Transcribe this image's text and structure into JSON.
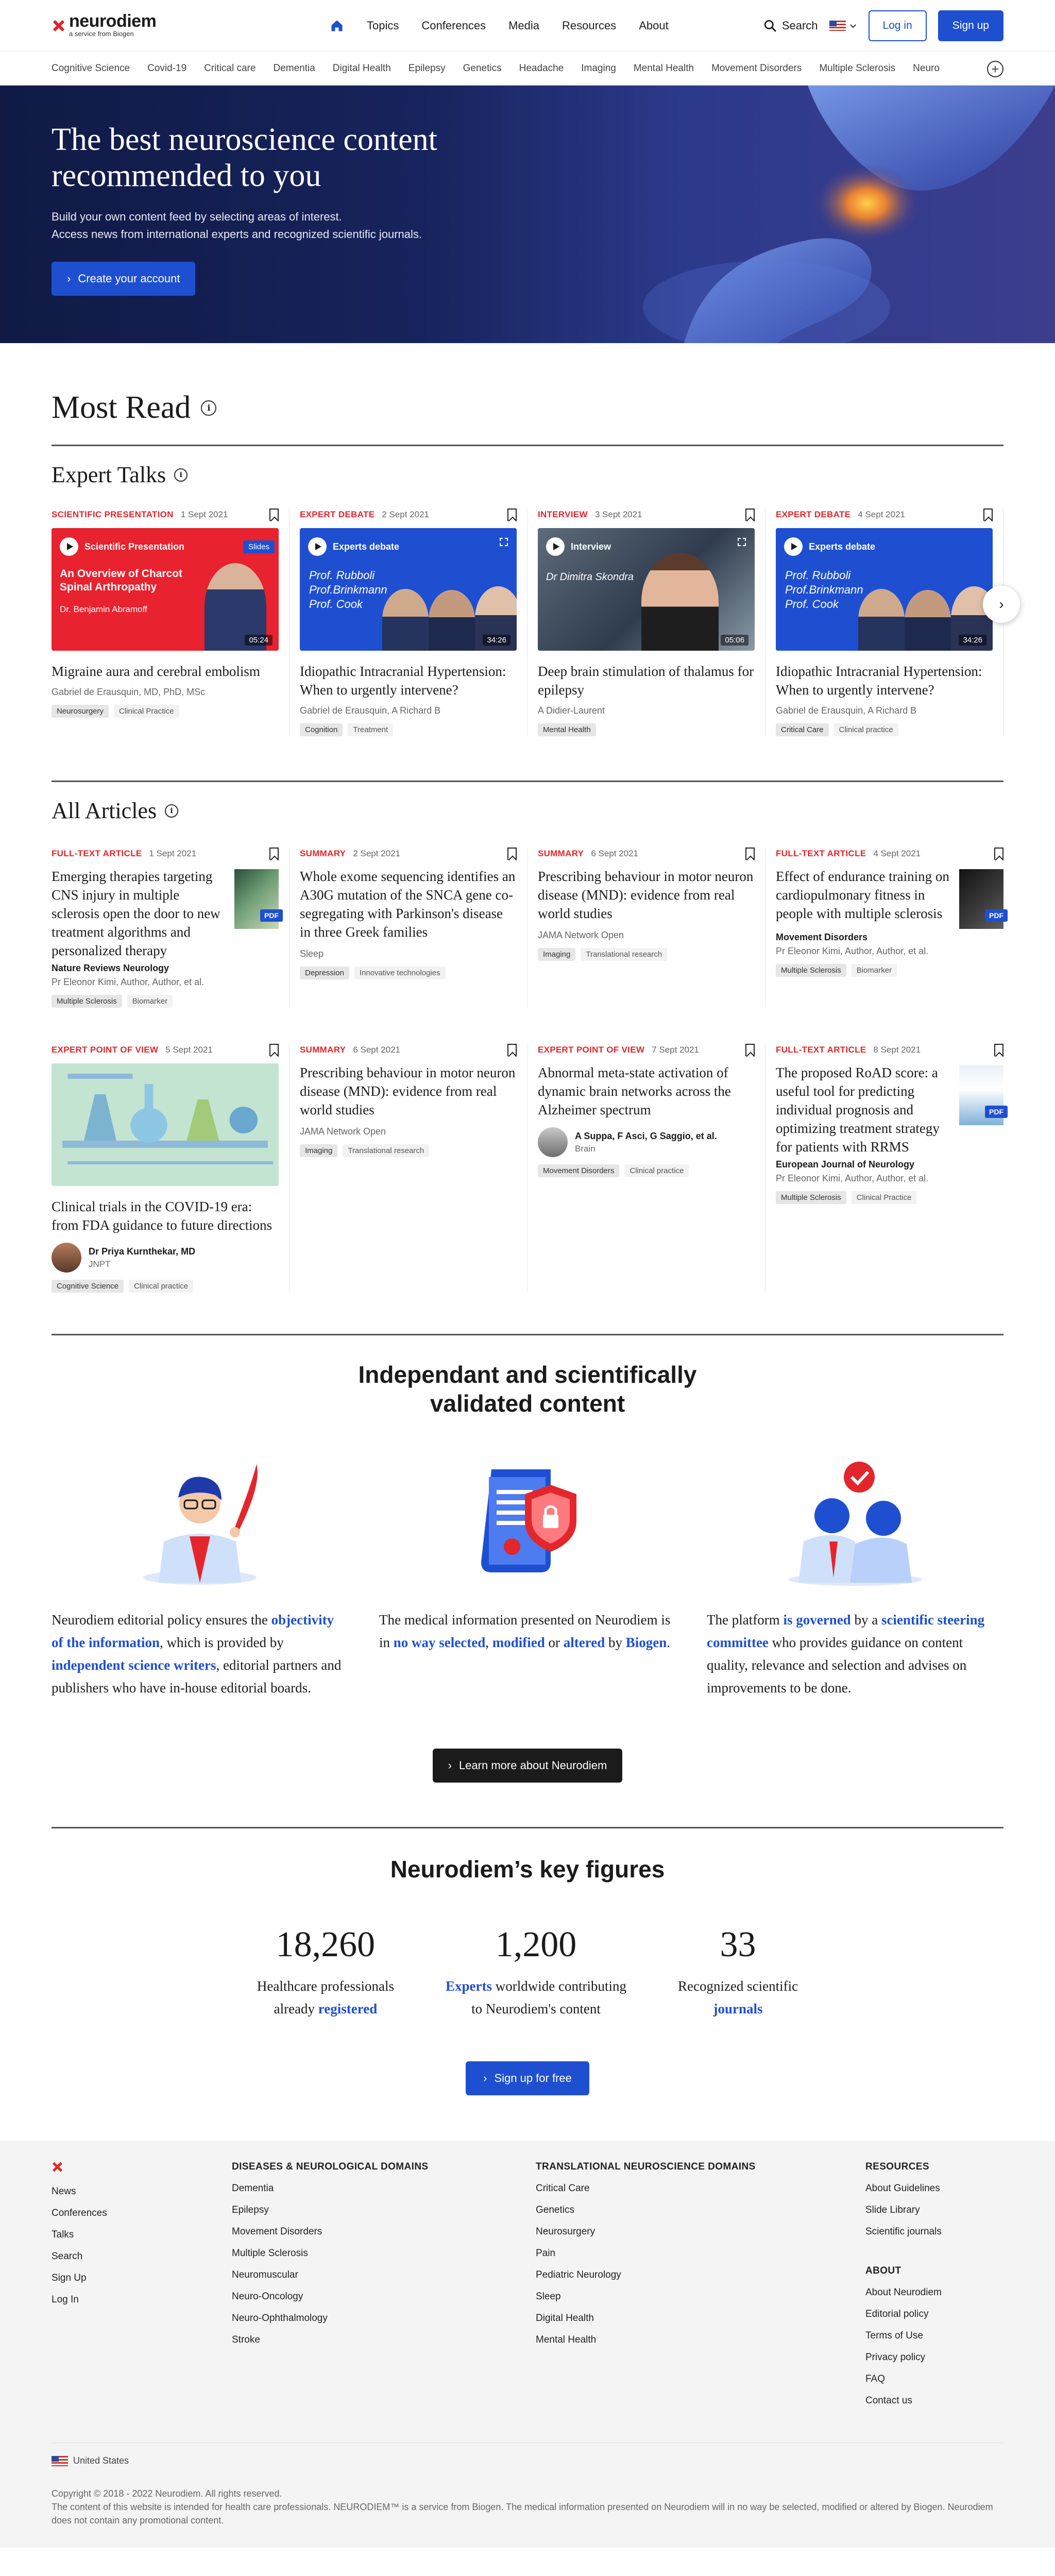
{
  "header": {
    "logo_text": "neurodiem",
    "logo_sub": "a service from Biogen",
    "nav": [
      "Topics",
      "Conferences",
      "Media",
      "Resources",
      "About"
    ],
    "search_label": "Search",
    "login_label": "Log in",
    "signup_label": "Sign up"
  },
  "subnav": [
    "Cognitive Science",
    "Covid-19",
    "Critical care",
    "Dementia",
    "Digital Health",
    "Epilepsy",
    "Genetics",
    "Headache",
    "Imaging",
    "Mental Health",
    "Movement Disorders",
    "Multiple Sclerosis",
    "Neuro"
  ],
  "hero": {
    "title": "The best neuroscience content recommended to you",
    "line1": "Build your own content feed by selecting areas of interest.",
    "line2": "Access news from international experts and recognized scientific journals.",
    "cta": "Create your account"
  },
  "most_read": "Most Read",
  "expert_talks": {
    "title": "Expert Talks",
    "cards": [
      {
        "tag": "SCIENTIFIC PRESENTATION",
        "date": "1 Sept 2021",
        "thumb_label": "Scientific Presentation",
        "thumb_badge": "Slides",
        "thumb_title": "An Overview of Charcot Spinal Arthropathy",
        "thumb_sub": "Dr. Benjamin Abramoff",
        "duration": "05:24",
        "title": "Migraine aura and cerebral embolism",
        "author": "Gabriel de Erausquin, MD, PhD, MSc",
        "chips": [
          "Neurosurgery",
          "Clinical Practice"
        ]
      },
      {
        "tag": "EXPERT DEBATE",
        "date": "2 Sept 2021",
        "thumb_label": "Experts debate",
        "thumb_names": [
          "Prof. Rubboli",
          "Prof.Brinkmann",
          "Prof. Cook"
        ],
        "duration": "34:26",
        "title": "Idiopathic Intracranial Hypertension: When to urgently intervene?",
        "author": "Gabriel de Erausquin, A Richard B",
        "chips": [
          "Cognition",
          "Treatment"
        ]
      },
      {
        "tag": "INTERVIEW",
        "date": "3 Sept 2021",
        "thumb_label": "Interview",
        "thumb_sub": "Dr Dimitra Skondra",
        "duration": "05:06",
        "title": "Deep brain stimulation of thalamus for epilepsy",
        "author": "A Didier-Laurent",
        "chips": [
          "Mental Health"
        ]
      },
      {
        "tag": "EXPERT DEBATE",
        "date": "4 Sept 2021",
        "thumb_label": "Experts debate",
        "thumb_names": [
          "Prof. Rubboli",
          "Prof.Brinkmann",
          "Prof. Cook"
        ],
        "duration": "34:26",
        "title": "Idiopathic Intracranial Hypertension: When to urgently intervene?",
        "author": "Gabriel de Erausquin, A Richard B",
        "chips": [
          "Critical Care",
          "Clinical practice"
        ]
      }
    ]
  },
  "all_articles": {
    "title": "All Articles",
    "row1": [
      {
        "tag": "FULL-TEXT ARTICLE",
        "date": "1 Sept 2021",
        "title": "Emerging therapies targeting CNS injury in multiple sclerosis open the door to new treatment algorithms and personalized therapy",
        "journal": "Nature Reviews Neurology",
        "author": "Pr Eleonor Kimi, Author, Author, et al.",
        "pdf": "PDF",
        "chips": [
          "Multiple Sclerosis",
          "Biomarker"
        ]
      },
      {
        "tag": "SUMMARY",
        "date": "2 Sept 2021",
        "title": "Whole exome sequencing identifies an A30G mutation of the SNCA gene co-segregating with Parkinson's disease in three Greek families",
        "source": "Sleep",
        "chips": [
          "Depression",
          "Innovative technologies"
        ]
      },
      {
        "tag": "SUMMARY",
        "date": "6 Sept 2021",
        "title": "Prescribing behaviour in motor neuron disease (MND): evidence from real world studies",
        "source": "JAMA Network Open",
        "chips": [
          "Imaging",
          "Translational research"
        ]
      },
      {
        "tag": "FULL-TEXT ARTICLE",
        "date": "4 Sept 2021",
        "title": "Effect of endurance training on cardiopulmonary fitness in people with multiple sclerosis",
        "journal": "Movement Disorders",
        "author": "Pr Eleonor Kimi, Author, Author, et al.",
        "pdf": "PDF",
        "chips": [
          "Multiple Sclerosis",
          "Biomarker"
        ]
      }
    ],
    "row2": [
      {
        "tag": "EXPERT POINT OF VIEW",
        "date": "5 Sept 2021",
        "title": "Clinical trials in the COVID-19 era: from FDA guidance to future directions",
        "byline_name": "Dr Priya Kurnthekar, MD",
        "byline_source": "JNPT",
        "chips": [
          "Cognitive Science",
          "Clinical practice"
        ]
      },
      {
        "tag": "SUMMARY",
        "date": "6 Sept 2021",
        "title": "Prescribing behaviour in motor neuron disease (MND): evidence from real world studies",
        "source": "JAMA Network Open",
        "chips": [
          "Imaging",
          "Translational research"
        ]
      },
      {
        "tag": "EXPERT POINT OF VIEW",
        "date": "7 Sept 2021",
        "title": "Abnormal meta-state activation of dynamic brain networks across the Alzheimer spectrum",
        "byline_name": "A Suppa, F Asci, G Saggio, et al.",
        "byline_source": "Brain",
        "chips": [
          "Movement Disorders",
          "Clinical practice"
        ]
      },
      {
        "tag": "FULL-TEXT ARTICLE",
        "date": "8 Sept 2021",
        "title": "The proposed RoAD score: a useful tool for predicting individual prognosis and optimizing treatment strategy for patients with RRMS",
        "journal": "European Journal of Neurology",
        "author": "Pr Eleonor Kimi, Author, Author, et al.",
        "pdf": "PDF",
        "chips": [
          "Multiple Sclerosis",
          "Clinical Practice"
        ]
      }
    ]
  },
  "independent": {
    "title_line1": "Independant and scientifically",
    "title_line2": "validated content",
    "p1": {
      "a": "Neurodiem editorial policy ensures the ",
      "b": "objectivity of the information",
      "c": ", which is provided by ",
      "d": "independent science writers",
      "e": ", editorial partners and publishers who have in-house editorial boards."
    },
    "p2": {
      "a": "The medical information presented on Neurodiem is in ",
      "b": "no way selected",
      "c": ", ",
      "d": "modified",
      "e": " or ",
      "f": "altered",
      "g": " by ",
      "h": "Biogen",
      "i": "."
    },
    "p3": {
      "a": "The platform ",
      "b": "is governed",
      "c": " by a ",
      "d": "scientific steering committee",
      "e": " who provides guidance on content quality, relevance and selection and advises on improvements to be done."
    },
    "cta": "Learn more about Neurodiem"
  },
  "key_figures": {
    "title": "Neurodiem’s key figures",
    "figures": [
      {
        "num": "18,260",
        "l1": "Healthcare professionals",
        "l2a": "already ",
        "l2b": "registered"
      },
      {
        "num": "1,200",
        "l1a": "Experts",
        "l1b": " worldwide contributing",
        "l2": "to Neurodiem's content"
      },
      {
        "num": "33",
        "l1": "Recognized scientific",
        "l2": "journals"
      }
    ],
    "cta": "Sign up for free"
  },
  "footer": {
    "col1": [
      "News",
      "Conferences",
      "Talks",
      "Search",
      "Sign Up",
      "Log In"
    ],
    "col2_title": "DISEASES & NEUROLOGICAL DOMAINS",
    "col2": [
      "Dementia",
      "Epilepsy",
      "Movement Disorders",
      "Multiple Sclerosis",
      "Neuromuscular",
      "Neuro-Oncology",
      "Neuro-Ophthalmology",
      "Stroke"
    ],
    "col3_title": "TRANSLATIONAL NEUROSCIENCE DOMAINS",
    "col3": [
      "Critical Care",
      "Genetics",
      "Neurosurgery",
      "Pain",
      "Pediatric Neurology",
      "Sleep",
      "Digital Health",
      "Mental Health"
    ],
    "col4_title": "RESOURCES",
    "col4": [
      "About Guidelines",
      "Slide Library",
      "Scientific journals"
    ],
    "col5_title": "ABOUT",
    "col5": [
      "About Neurodiem",
      "Editorial policy",
      "Terms of Use",
      "Privacy policy",
      "FAQ",
      "Contact us"
    ],
    "country": "United States",
    "copy1": "Copyright © 2018 - 2022 Neurodiem. All rights reserved.",
    "copy2": "The content of this website is intended for health care professionals. NEURODIEM™ is a service from Biogen. The medical information presented on Neurodiem will in no way be selected, modified or altered by Biogen. Neurodiem does not contain any promotional content."
  },
  "colors": {
    "accent": "#1f4fd1",
    "brand_red": "#e3262b",
    "hero_dark": "#17235c"
  }
}
